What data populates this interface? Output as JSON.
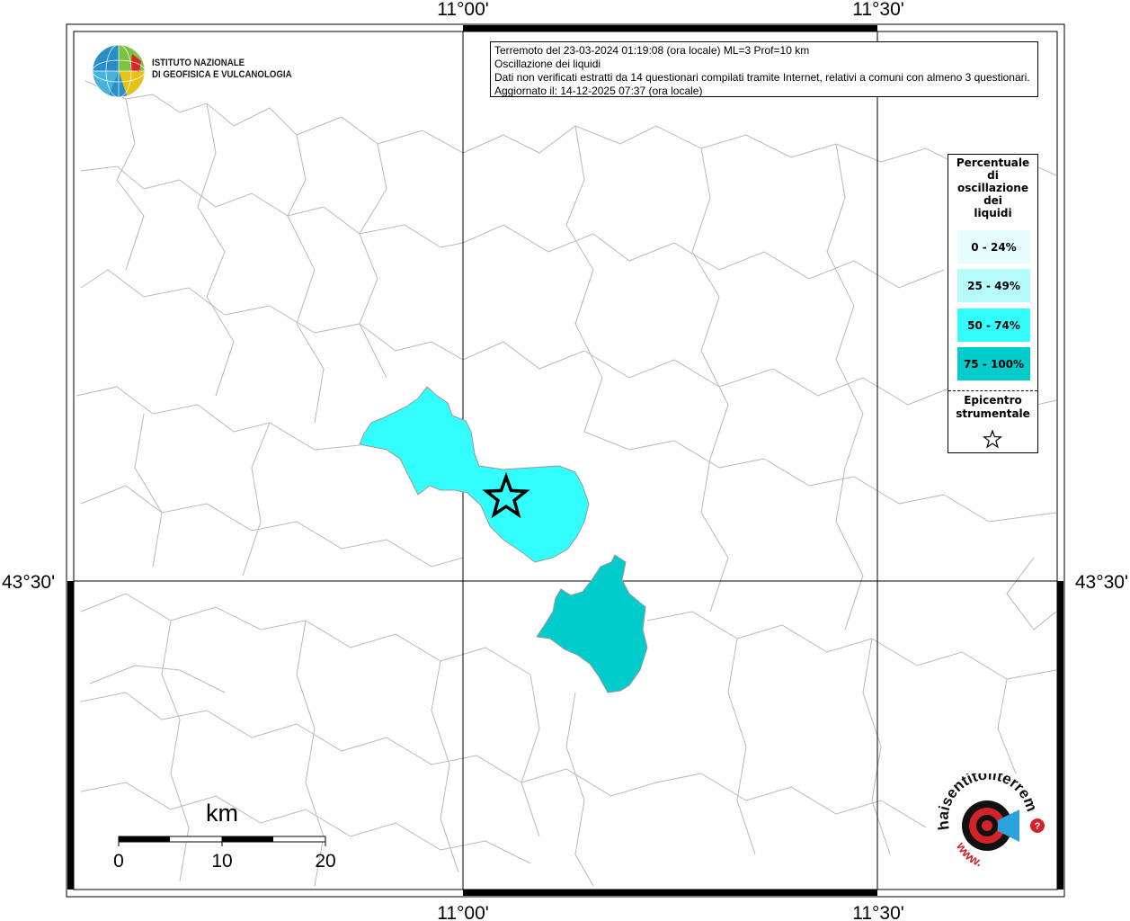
{
  "map": {
    "lon_labels": [
      "11°00'",
      "11°30'"
    ],
    "lat_labels": [
      "43°30'"
    ]
  },
  "info": {
    "line1": "Terremoto del 23-03-2024 01:19:08 (ora locale) ML=3 Prof=10 km",
    "line2": "Oscillazione dei liquidi",
    "line3": "Dati non verificati estratti da 14 questionari compilati tramite Internet, relativi a comuni con almeno 3 questionari.",
    "line4": "Aggiornato il: 14-12-2025 07:37 (ora locale)"
  },
  "legend": {
    "title": "Percentuale di oscillazione dei liquidi",
    "title_lines": [
      "Percentuale",
      "di",
      "oscillazione",
      "dei",
      "liquidi"
    ],
    "classes": [
      {
        "label": "0 - 24%",
        "color": "#e6fefe"
      },
      {
        "label": "25 - 49%",
        "color": "#b6fcfc"
      },
      {
        "label": "50 - 74%",
        "color": "#33fefe"
      },
      {
        "label": "75 - 100%",
        "color": "#00cccc"
      }
    ],
    "epicenter_lines": [
      "Epicentro",
      "strumentale"
    ]
  },
  "regions": [
    {
      "name": "comune-north",
      "class": "50 - 74%",
      "color": "#33fefe"
    },
    {
      "name": "comune-south",
      "class": "75 - 100%",
      "color": "#00cccc"
    }
  ],
  "epicenter": {
    "symbol": "star"
  },
  "scale_bar": {
    "unit": "km",
    "ticks": [
      "0",
      "10",
      "20"
    ]
  },
  "logos": {
    "ingv_line1": "ISTITUTO NAZIONALE",
    "ingv_line2": "DI GEOFISICA E VULCANOLOGIA",
    "hst_text": "www.haisentitoilterremoto.it"
  }
}
